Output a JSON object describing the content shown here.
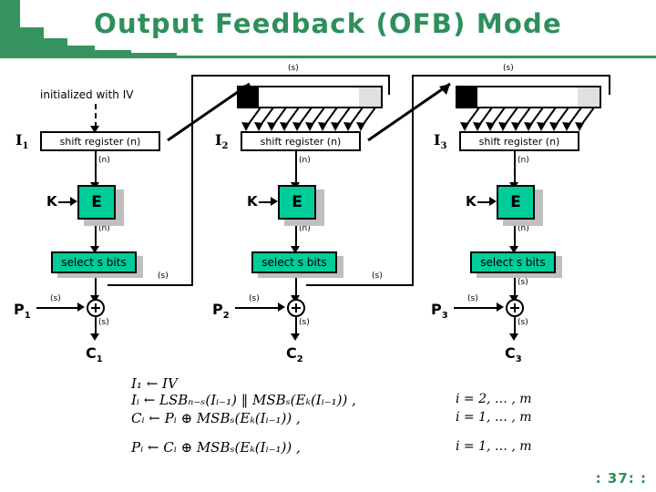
{
  "slide": {
    "title": "Output Feedback (OFB) Mode",
    "page_number": ": 37: :",
    "accent_color": "#35945f",
    "title_color": "#2f8f5b",
    "block_color": "#00cc99",
    "shadow_color": "#bfbfbf"
  },
  "diagram": {
    "init_note": "initialized with IV",
    "stages": [
      {
        "input_label": "I",
        "input_sub": "1",
        "shift_register_label": "shift register (n)",
        "cipher_label": "E",
        "key_label": "K",
        "select_label": "select s bits",
        "plaintext_label": "P",
        "plaintext_sub": "1",
        "ciphertext_label": "C",
        "ciphertext_sub": "1",
        "width_n_label": "(n)",
        "width_s_label": "(s)"
      },
      {
        "input_label": "I",
        "input_sub": "2",
        "shift_register_label": "shift register (n)",
        "cipher_label": "E",
        "key_label": "K",
        "select_label": "select s bits",
        "plaintext_label": "P",
        "plaintext_sub": "2",
        "ciphertext_label": "C",
        "ciphertext_sub": "2",
        "width_n_label": "(n)",
        "width_s_label": "(s)"
      },
      {
        "input_label": "I",
        "input_sub": "3",
        "shift_register_label": "shift register (n)",
        "cipher_label": "E",
        "key_label": "K",
        "select_label": "select s bits",
        "plaintext_label": "P",
        "plaintext_sub": "3",
        "ciphertext_label": "C",
        "ciphertext_sub": "3",
        "width_n_label": "(n)",
        "width_s_label": "(s)"
      }
    ],
    "feedback_label": "(s)"
  },
  "formulas": {
    "lines": [
      {
        "lhs": "I",
        "lhs_sub": "1",
        "body": "← IV",
        "condition": ""
      },
      {
        "lhs": "I",
        "lhs_sub": "i",
        "body": "← LSB",
        "condition": "i = 2, … , m"
      },
      {
        "lhs": "C",
        "lhs_sub": "i",
        "body": "← P",
        "condition": "i = 1, … , m"
      },
      {
        "lhs": "P",
        "lhs_sub": "i",
        "body": "← C",
        "condition": "i = 1, … , m"
      }
    ],
    "line1": "I₁ ← IV",
    "line2": "Iᵢ ← LSBₙ₋ₛ(Iᵢ₋₁) ‖ MSBₛ(Eₖ(Iᵢ₋₁)) ,",
    "line2_cond": "i = 2, … , m",
    "line3": "Cᵢ ← Pᵢ ⊕ MSBₛ(Eₖ(Iᵢ₋₁)) ,",
    "line3_cond": "i = 1, … , m",
    "line4": "Pᵢ ← Cᵢ ⊕ MSBₛ(Eₖ(Iᵢ₋₁)) ,",
    "line4_cond": "i = 1, … , m"
  }
}
